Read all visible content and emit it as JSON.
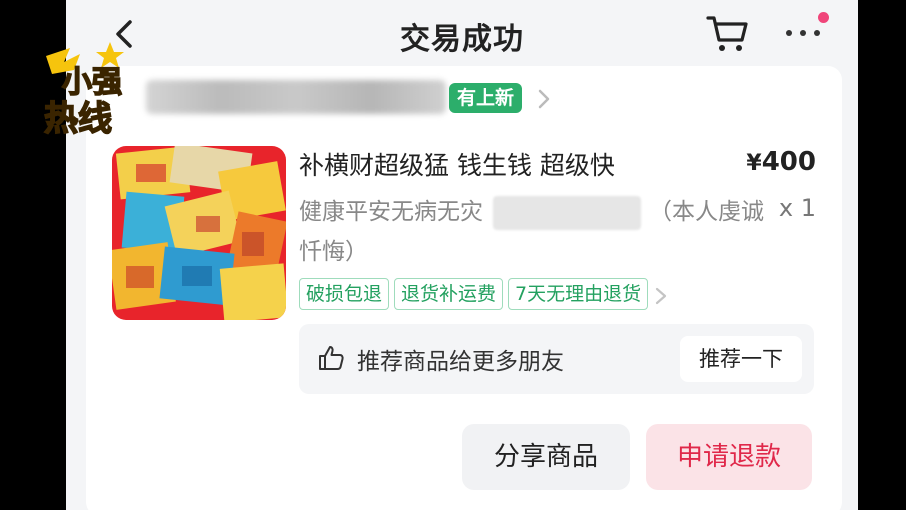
{
  "header": {
    "title": "交易成功"
  },
  "shop": {
    "badge": "有上新"
  },
  "product": {
    "name": "补横财超级猛  钱生钱 超级快",
    "price_symbol": "¥",
    "price": "400",
    "quantity": "x 1",
    "spec_prefix": "健康平安无病无灾",
    "spec_suffix": "（本人虔诚忏悔）"
  },
  "tags": [
    "破损包退",
    "退货补运费",
    "7天无理由退货"
  ],
  "recommend": {
    "text": "推荐商品给更多朋友",
    "button": "推荐一下"
  },
  "actions": {
    "share": "分享商品",
    "refund": "申请退款"
  },
  "watermark": {
    "line1": "小强",
    "line2": "热线"
  },
  "colors": {
    "accent_green": "#2cae6b",
    "refund_red": "#e0284a",
    "notification_dot": "#f0457a"
  }
}
